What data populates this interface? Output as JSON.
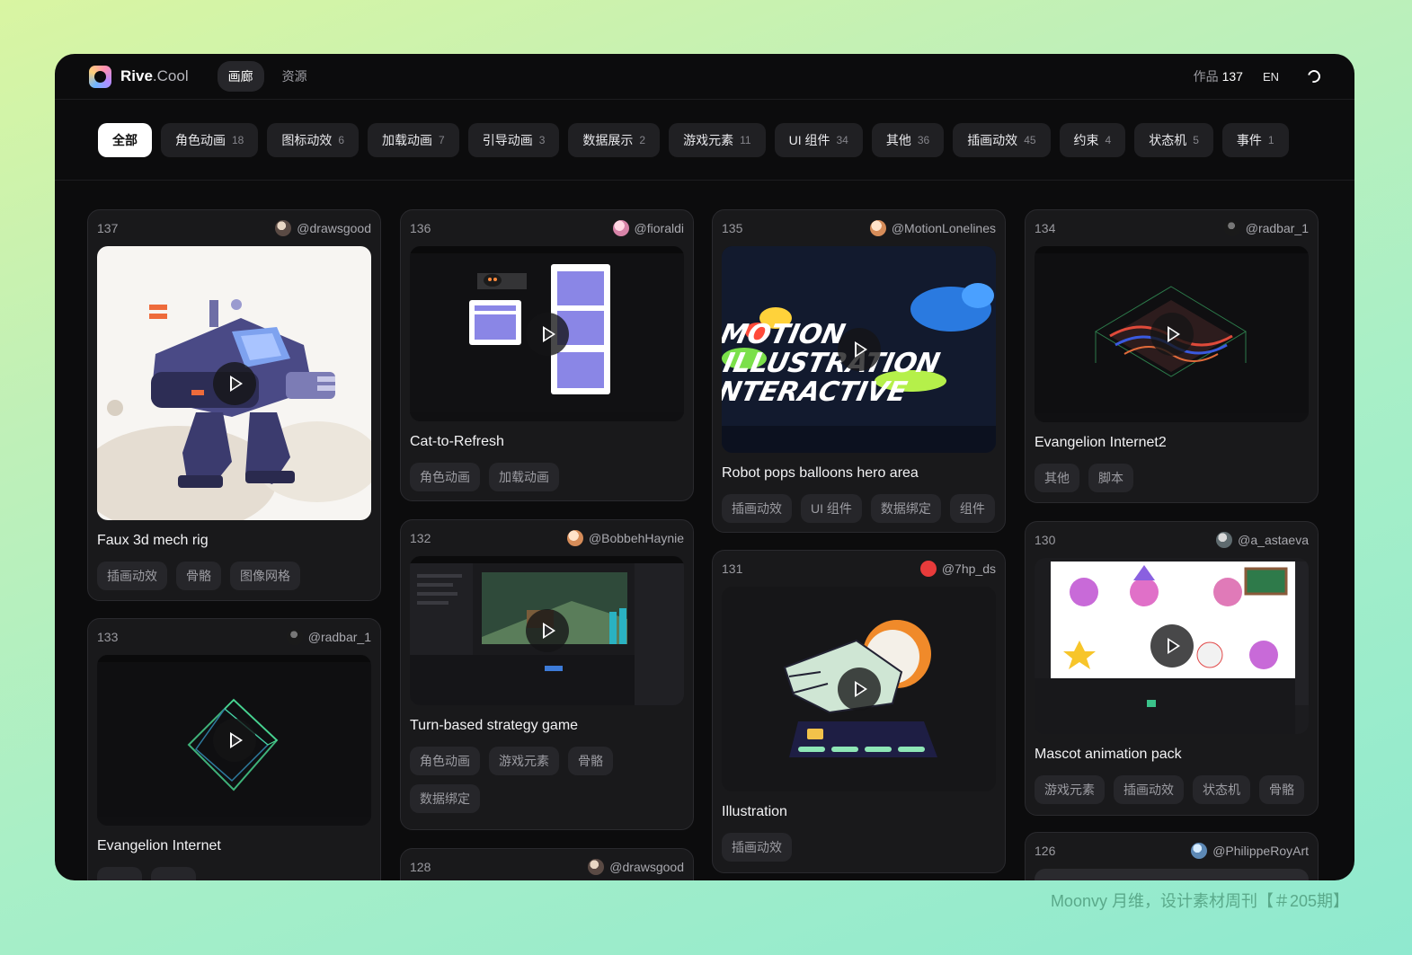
{
  "app": {
    "logo_main": "Rive",
    "logo_suffix": ".Cool",
    "nav": [
      {
        "label": "画廊"
      },
      {
        "label": "资源"
      }
    ],
    "works_label": "作品",
    "works_count": "137",
    "lang": "EN"
  },
  "filters": [
    {
      "label": "全部",
      "count": ""
    },
    {
      "label": "角色动画",
      "count": "18"
    },
    {
      "label": "图标动效",
      "count": "6"
    },
    {
      "label": "加载动画",
      "count": "7"
    },
    {
      "label": "引导动画",
      "count": "3"
    },
    {
      "label": "数据展示",
      "count": "2"
    },
    {
      "label": "游戏元素",
      "count": "11"
    },
    {
      "label": "UI 组件",
      "count": "34"
    },
    {
      "label": "其他",
      "count": "36"
    },
    {
      "label": "插画动效",
      "count": "45"
    },
    {
      "label": "约束",
      "count": "4"
    },
    {
      "label": "状态机",
      "count": "5"
    },
    {
      "label": "事件",
      "count": "1"
    }
  ],
  "cards": [
    {
      "id": "137",
      "author": "@drawsgood",
      "title": "Faux 3d mech rig",
      "tags": [
        "插画动效",
        "骨骼",
        "图像网格"
      ]
    },
    {
      "id": "136",
      "author": "@fioraldi",
      "title": "Cat-to-Refresh",
      "tags": [
        "角色动画",
        "加载动画"
      ]
    },
    {
      "id": "135",
      "author": "@MotionLonelines",
      "title": "Robot pops balloons hero area",
      "tags": [
        "插画动效",
        "UI 组件",
        "数据绑定",
        "组件"
      ]
    },
    {
      "id": "134",
      "author": "@radbar_1",
      "title": "Evangelion Internet2",
      "tags": [
        "其他",
        "脚本"
      ]
    },
    {
      "id": "133",
      "author": "@radbar_1",
      "title": "Evangelion Internet",
      "tags": []
    },
    {
      "id": "132",
      "author": "@BobbehHaynie",
      "title": "Turn-based strategy game",
      "tags": [
        "角色动画",
        "游戏元素",
        "骨骼",
        "数据绑定"
      ]
    },
    {
      "id": "131",
      "author": "@7hp_ds",
      "title": "Illustration",
      "tags": [
        "插画动效"
      ]
    },
    {
      "id": "130",
      "author": "@a_astaeva",
      "title": "Mascot animation pack",
      "tags": [
        "游戏元素",
        "插画动效",
        "状态机",
        "骨骼"
      ]
    },
    {
      "id": "128",
      "author": "@drawsgood",
      "title": "",
      "tags": []
    },
    {
      "id": "126",
      "author": "@PhilippeRoyArt",
      "title": "",
      "tags": []
    }
  ],
  "preview_art": {
    "motion_line1": "MOTION",
    "motion_line2": "ILLUSTRATION",
    "motion_line3": "INTERACTIVE"
  },
  "watermark": "Moonvy 月维，设计素材周刊【＃205期】",
  "colors": {
    "page_bg_start": "#d9f5a2",
    "page_bg_end": "#8fe9cf",
    "app_bg": "#0c0c0d",
    "card_bg": "#19191b",
    "chip_active_bg": "#ffffff",
    "watermark": "#5aa98a"
  }
}
